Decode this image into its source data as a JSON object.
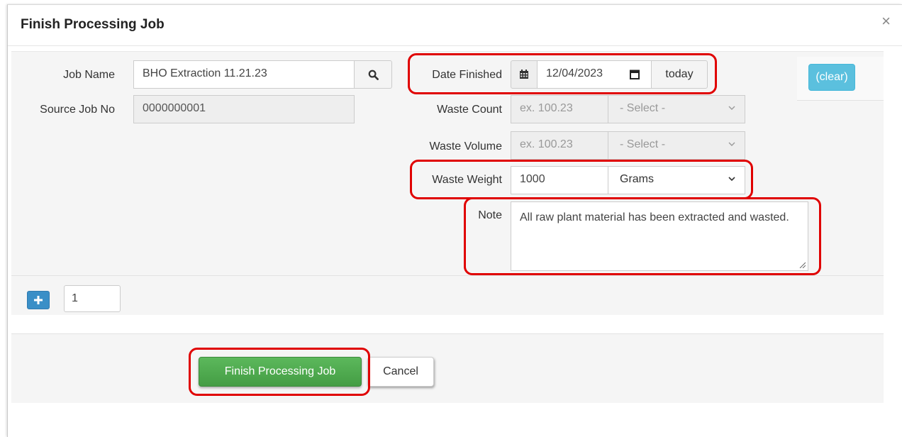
{
  "modal": {
    "title": "Finish Processing Job",
    "close_label": "×"
  },
  "form": {
    "job_name": {
      "label": "Job Name",
      "value": "BHO Extraction 11.21.23"
    },
    "source_job_no": {
      "label": "Source Job No",
      "value": "0000000001"
    },
    "date_finished": {
      "label": "Date Finished",
      "value": "12/04/2023",
      "today_label": "today"
    },
    "waste_count": {
      "label": "Waste Count",
      "placeholder": "ex. 100.23",
      "unit": "- Select -"
    },
    "waste_volume": {
      "label": "Waste Volume",
      "placeholder": "ex. 100.23",
      "unit": "- Select -"
    },
    "waste_weight": {
      "label": "Waste Weight",
      "value": "1000",
      "unit": "Grams"
    },
    "note": {
      "label": "Note",
      "value": "All raw plant material has been extracted and wasted."
    },
    "clear_label": "(clear)"
  },
  "add_row": {
    "quantity": "1"
  },
  "footer": {
    "finish_label": "Finish Processing Job",
    "cancel_label": "Cancel"
  },
  "colors": {
    "highlight": "#e00000",
    "info_button": "#5bc0de",
    "primary_button": "#3a8fc7",
    "success_button": "#5cb85c"
  },
  "icons": {
    "search": "search-icon",
    "calendar": "calendar-icon",
    "calendar_picker": "calendar-picker-icon",
    "chevron": "chevron-down-icon",
    "plus": "plus-icon",
    "close": "close-icon"
  }
}
